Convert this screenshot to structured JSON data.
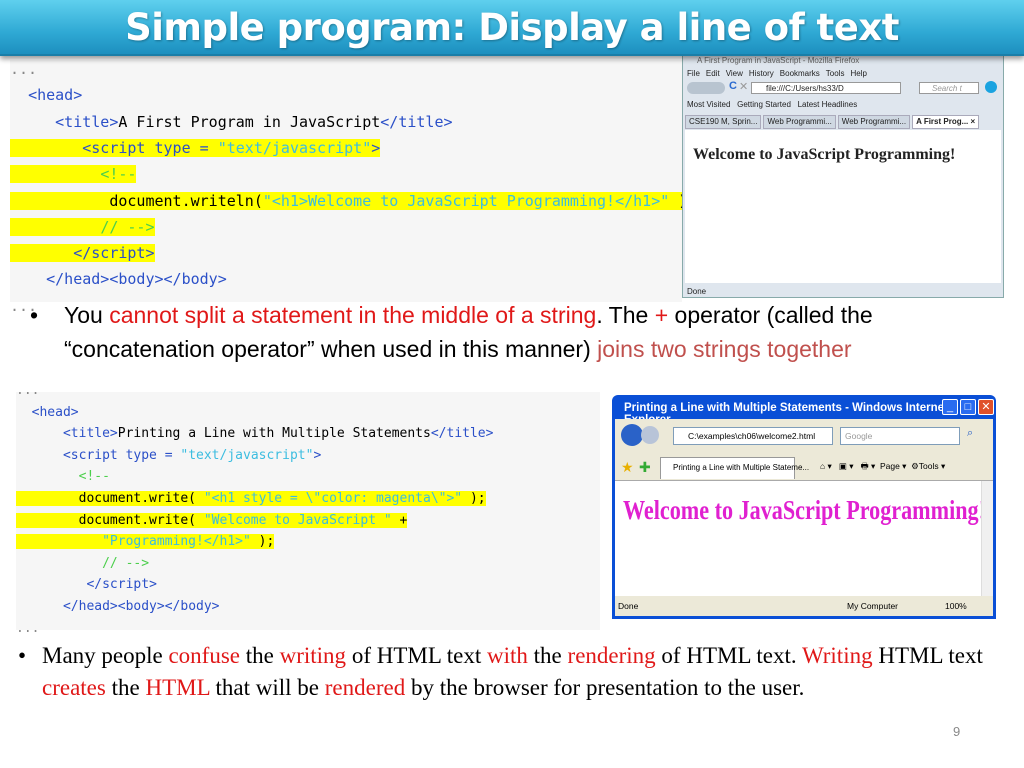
{
  "title": "Simple program: Display a line of text",
  "code1": {
    "lines": [
      {
        "hl": false,
        "segs": [
          [
            "e",
            "..."
          ]
        ]
      },
      {
        "hl": false,
        "segs": [
          [
            "k",
            "  "
          ],
          [
            "t",
            "<head>"
          ]
        ]
      },
      {
        "hl": false,
        "segs": [
          [
            "k",
            "     "
          ],
          [
            "t",
            "<title>"
          ],
          [
            "k",
            "A First Program in JavaScript"
          ],
          [
            "t",
            "</title>"
          ]
        ]
      },
      {
        "hl": true,
        "segs": [
          [
            "k",
            "        "
          ],
          [
            "t",
            "<script type = "
          ],
          [
            "s",
            "\"text/javascript\""
          ],
          [
            "t",
            ">"
          ]
        ]
      },
      {
        "hl": true,
        "segs": [
          [
            "k",
            "          "
          ],
          [
            "c",
            "<!--"
          ]
        ]
      },
      {
        "hl": true,
        "segs": [
          [
            "k",
            "           document.writeln("
          ],
          [
            "s",
            "\"<h1>Welcome to JavaScript Programming!</h1>\""
          ],
          [
            "k",
            " );"
          ]
        ]
      },
      {
        "hl": true,
        "segs": [
          [
            "k",
            "          "
          ],
          [
            "c",
            "// -->"
          ]
        ]
      },
      {
        "hl": true,
        "segs": [
          [
            "k",
            "       "
          ],
          [
            "t",
            "</script>"
          ]
        ]
      },
      {
        "hl": false,
        "segs": [
          [
            "k",
            "    "
          ],
          [
            "t",
            "</head><body></body>"
          ]
        ]
      },
      {
        "hl": false,
        "segs": [
          [
            "e",
            "..."
          ]
        ]
      }
    ]
  },
  "firefox": {
    "window_title": "A First Program in JavaScript - Mozilla Firefox",
    "menu": [
      "File",
      "Edit",
      "View",
      "History",
      "Bookmarks",
      "Tools",
      "Help"
    ],
    "url": "file:///C:/Users/hs33/D",
    "search_placeholder": "Search t",
    "bookmarks": [
      "Most Visited",
      "Getting Started",
      "Latest Headlines"
    ],
    "tabs": [
      "CSE190 M, Sprin...",
      "Web Programmi...",
      "Web Programmi...",
      "A First Prog... ×"
    ],
    "heading": "Welcome to JavaScript Programming!",
    "status": "Done"
  },
  "bullet1": [
    [
      "k",
      "You "
    ],
    [
      "red",
      "cannot split a statement in the middle of a string"
    ],
    [
      "k",
      ". The "
    ],
    [
      "red",
      "+"
    ],
    [
      "k",
      " operator (called the “concatenation operator” when used in this manner) "
    ],
    [
      "red2",
      "joins two strings together"
    ]
  ],
  "code2": {
    "lines": [
      {
        "hl": false,
        "segs": [
          [
            "e",
            "..."
          ]
        ]
      },
      {
        "hl": false,
        "segs": [
          [
            "k",
            "  "
          ],
          [
            "t",
            "<head>"
          ]
        ]
      },
      {
        "hl": false,
        "segs": [
          [
            "k",
            "      "
          ],
          [
            "t",
            "<title>"
          ],
          [
            "k",
            "Printing a Line with Multiple Statements"
          ],
          [
            "t",
            "</title>"
          ]
        ]
      },
      {
        "hl": false,
        "segs": [
          [
            "k",
            "      "
          ],
          [
            "t",
            "<script type = "
          ],
          [
            "s",
            "\"text/javascript\""
          ],
          [
            "t",
            ">"
          ]
        ]
      },
      {
        "hl": false,
        "segs": [
          [
            "k",
            "        "
          ],
          [
            "c",
            "<!--"
          ]
        ]
      },
      {
        "hl": true,
        "segs": [
          [
            "k",
            "        document.write( "
          ],
          [
            "s",
            "\"<h1 style = \\\"color: magenta\\\">\""
          ],
          [
            "k",
            " );"
          ]
        ]
      },
      {
        "hl": true,
        "segs": [
          [
            "k",
            "        document.write( "
          ],
          [
            "s",
            "\"Welcome to JavaScript \""
          ],
          [
            "k",
            " +"
          ]
        ]
      },
      {
        "hl": true,
        "segs": [
          [
            "k",
            "           "
          ],
          [
            "s",
            "\"Programming!</h1>\""
          ],
          [
            "k",
            " );"
          ]
        ]
      },
      {
        "hl": false,
        "segs": [
          [
            "k",
            "           "
          ],
          [
            "c",
            "// -->"
          ]
        ]
      },
      {
        "hl": false,
        "segs": [
          [
            "k",
            "         "
          ],
          [
            "t",
            "</script>"
          ]
        ]
      },
      {
        "hl": false,
        "segs": [
          [
            "k",
            "      "
          ],
          [
            "t",
            "</head><body></body>"
          ]
        ]
      },
      {
        "hl": false,
        "segs": [
          [
            "e",
            "..."
          ]
        ]
      }
    ]
  },
  "ie": {
    "window_title": "Printing a Line with Multiple Statements - Windows Internet Explorer",
    "address": "C:\\examples\\ch06\\welcome2.html",
    "search_placeholder": "Google",
    "tab": "Printing a Line with Multiple Stateme...",
    "toolbar": [
      "Page ▾",
      "Tools ▾"
    ],
    "heading": "Welcome to JavaScript Programming!",
    "status": "Done",
    "zone": "My Computer",
    "zoom": "100%"
  },
  "bullet2": [
    [
      "k",
      "Many people "
    ],
    [
      "red",
      "confuse"
    ],
    [
      "k",
      " the "
    ],
    [
      "red",
      "writing"
    ],
    [
      "k",
      " of HTML text "
    ],
    [
      "red",
      "with"
    ],
    [
      "k",
      " the "
    ],
    [
      "red",
      "rendering"
    ],
    [
      "k",
      " of HTML text. "
    ],
    [
      "red",
      "Writing"
    ],
    [
      "k",
      " HTML text "
    ],
    [
      "red",
      "creates"
    ],
    [
      "k",
      " the "
    ],
    [
      "red",
      "HTML"
    ],
    [
      "k",
      " that will be "
    ],
    [
      "red",
      "rendered"
    ],
    [
      "k",
      " by the browser for presentation to the user."
    ]
  ],
  "page_number": "9"
}
